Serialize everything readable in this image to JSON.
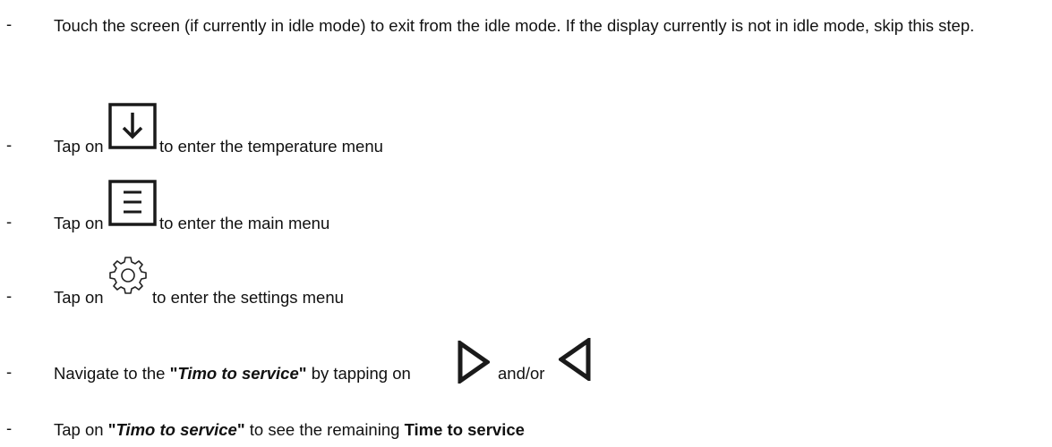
{
  "steps": [
    {
      "bullet": "-",
      "text": "Touch the screen (if currently in idle mode) to exit from the idle mode. If the display currently is not in idle mode, skip this step."
    },
    {
      "bullet": "-",
      "prefix": "Tap on",
      "icon": "down-arrow-box-icon",
      "suffix": "to enter the temperature menu"
    },
    {
      "bullet": "-",
      "prefix": "Tap on",
      "icon": "menu-box-icon",
      "suffix": "to enter the main menu"
    },
    {
      "bullet": "-",
      "prefix": "Tap on",
      "icon": "gear-icon",
      "suffix": "to enter the settings menu"
    },
    {
      "bullet": "-",
      "prefix": "Navigate to the",
      "quote_open": "\"",
      "emphasis": "Timo to service",
      "quote_close": "\"",
      "middle": "by tapping on",
      "icon_a": "right-triangle-icon",
      "connector": "and/or",
      "icon_b": "left-triangle-icon"
    },
    {
      "bullet": "-",
      "prefix": "Tap on",
      "quote_open": "\"",
      "emphasis": "Timo to service",
      "quote_close": "\"",
      "middle": "to see the remaining",
      "bold_end": "Time to service"
    }
  ]
}
